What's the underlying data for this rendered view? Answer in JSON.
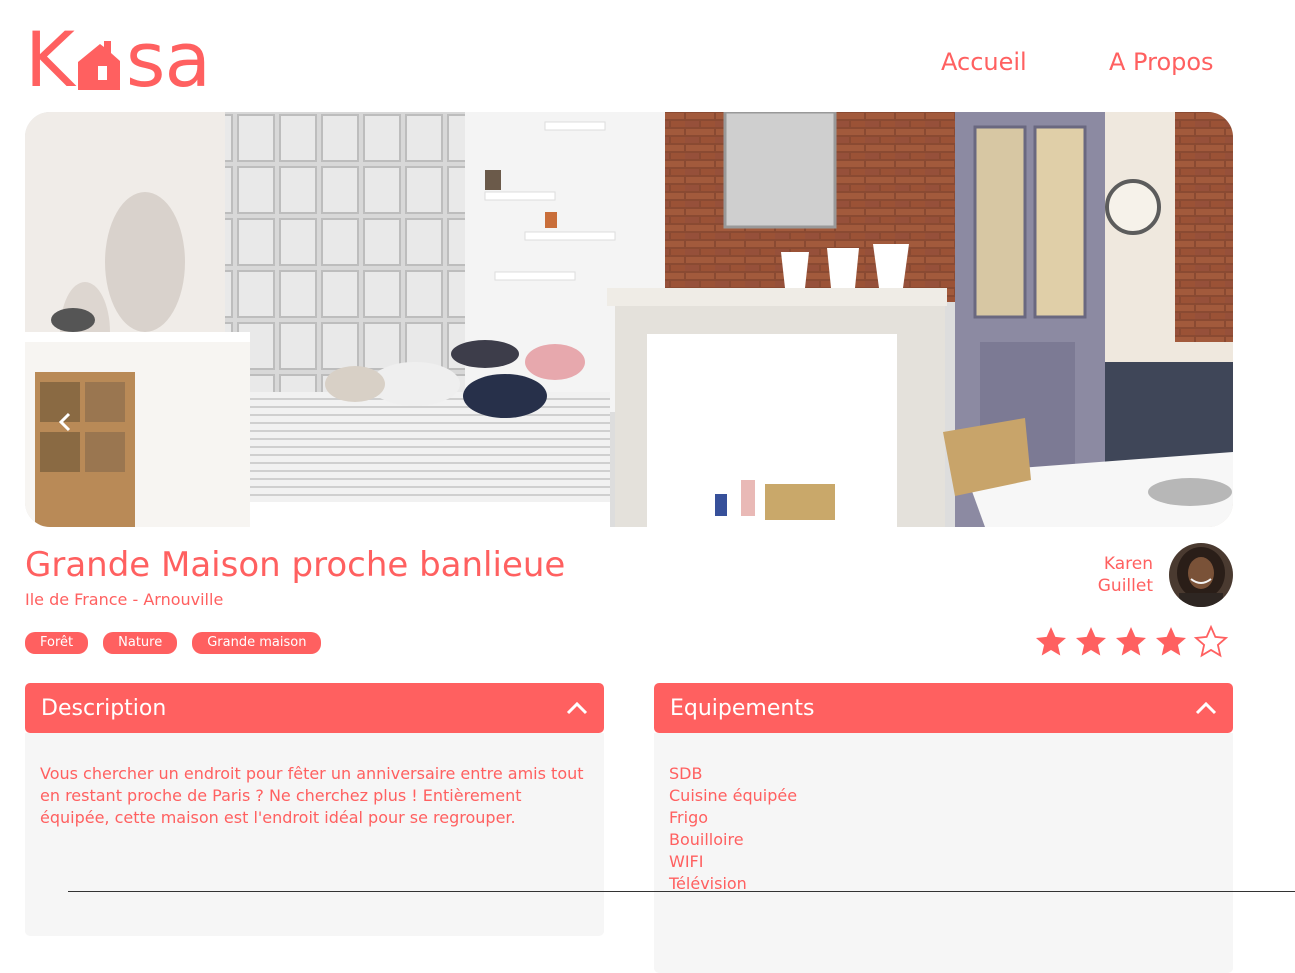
{
  "header": {
    "logo_left": "K",
    "logo_right": "sa",
    "logo_icon": "house-icon",
    "nav": [
      {
        "label": "Accueil"
      },
      {
        "label": "A Propos"
      }
    ]
  },
  "gallery": {
    "prev_icon": "chevron-left-icon",
    "next_icon": "chevron-right-icon"
  },
  "listing": {
    "title": "Grande Maison proche banlieue",
    "location": "Ile de France - Arnouville",
    "tags": [
      "Forêt",
      "Nature",
      "Grande maison"
    ],
    "host": {
      "first_name": "Karen",
      "last_name": "Guillet"
    },
    "rating": {
      "value": 4,
      "max": 5
    }
  },
  "description": {
    "title": "Description",
    "text": "Vous chercher un endroit pour fêter un anniversaire entre amis tout en restant proche de Paris ? Ne cherchez plus ! Entièrement équipée, cette maison est l'endroit idéal pour se regrouper."
  },
  "equipments": {
    "title": "Equipements",
    "items": [
      "SDB",
      "Cuisine équipée",
      "Frigo",
      "Bouilloire",
      "WIFI",
      "Télévision"
    ]
  },
  "colors": {
    "accent": "#FF6060",
    "panel": "#F6F6F6",
    "star_off": "#E3E3E3"
  }
}
